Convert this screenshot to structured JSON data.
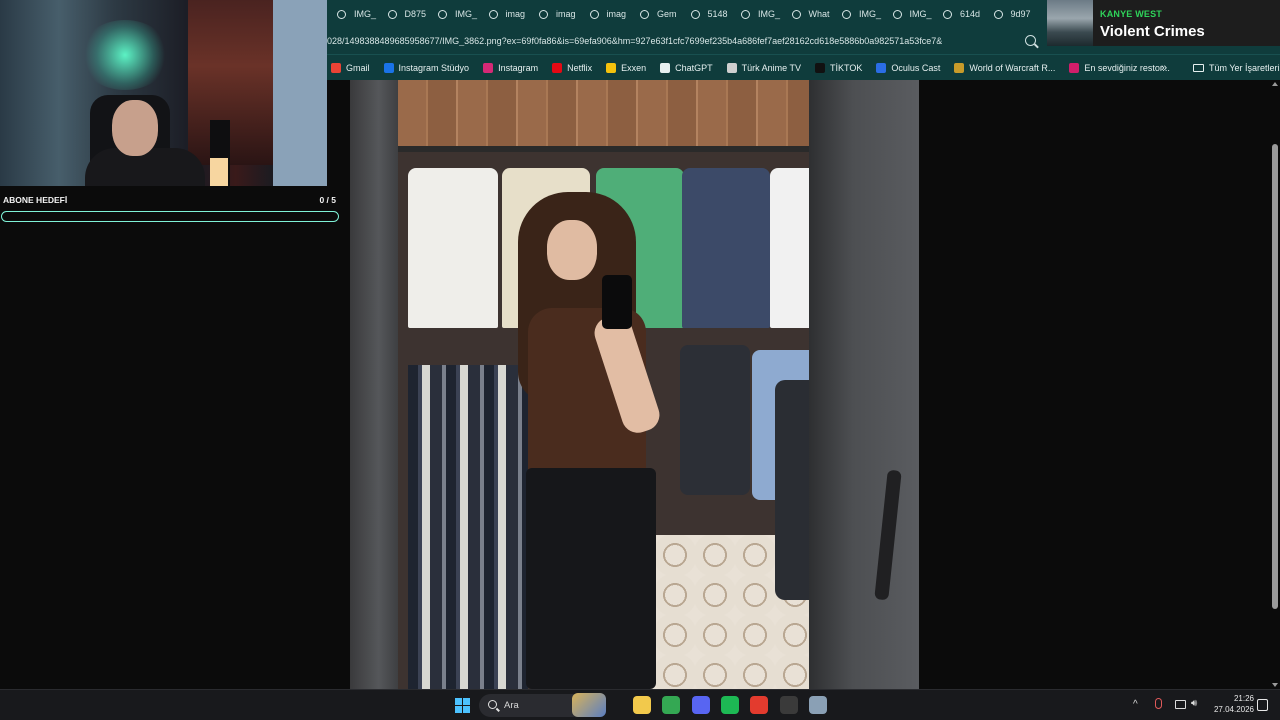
{
  "browser": {
    "tabs": [
      {
        "label": "IMG_"
      },
      {
        "label": "D875"
      },
      {
        "label": "IMG_"
      },
      {
        "label": "imag"
      },
      {
        "label": "imag"
      },
      {
        "label": "imag"
      },
      {
        "label": "Gem"
      },
      {
        "label": "5148"
      },
      {
        "label": "IMG_"
      },
      {
        "label": "What"
      },
      {
        "label": "IMG_"
      },
      {
        "label": "IMG_"
      },
      {
        "label": "614d"
      },
      {
        "label": "9d97"
      }
    ],
    "url": "028/1498388489685958677/IMG_3862.png?ex=69f0fa86&is=69efa906&hm=927e63f1cfc7699ef235b4a686fef7aef28162cd618e5886b0a982571a53fce7&",
    "bookmarks": [
      {
        "label": "Gmail",
        "color": "#ea4335"
      },
      {
        "label": "Instagram Stüdyo",
        "color": "#1a73e8"
      },
      {
        "label": "Instagram",
        "color": "#d62976"
      },
      {
        "label": "Netflix",
        "color": "#e50914"
      },
      {
        "label": "Exxen",
        "color": "#f4c20d"
      },
      {
        "label": "ChatGPT",
        "color": "#e6f0f0"
      },
      {
        "label": "Türk Anime TV",
        "color": "#cfcfcf"
      },
      {
        "label": "TİKTOK",
        "color": "#111111"
      },
      {
        "label": "Oculus Cast",
        "color": "#2b6de5"
      },
      {
        "label": "World of Warcraft R...",
        "color": "#c89b2a"
      },
      {
        "label": "En sevdiğiniz restor...",
        "color": "#d11e6a"
      }
    ],
    "more_label": "»",
    "all_bookmarks_label": "Tüm Yer İşaretleri"
  },
  "now_playing": {
    "artist": "KANYE WEST",
    "title": "Violent Crimes"
  },
  "subscriber_goal": {
    "label": "ABONE HEDEFİ",
    "count_text": "0 / 5",
    "progress": 0
  },
  "taskbar": {
    "search_placeholder": "Ara",
    "apps": [
      {
        "name": "file-explorer",
        "color": "#f2c94c"
      },
      {
        "name": "chrome",
        "color": "#34a853"
      },
      {
        "name": "discord",
        "color": "#5865f2"
      },
      {
        "name": "spotify",
        "color": "#1db954"
      },
      {
        "name": "streaming-app",
        "color": "#e33b2e"
      },
      {
        "name": "obs",
        "color": "#3a3a3a"
      },
      {
        "name": "settings",
        "color": "#8aa0b5"
      }
    ],
    "time": "21:26",
    "date": "27.04.2026"
  }
}
